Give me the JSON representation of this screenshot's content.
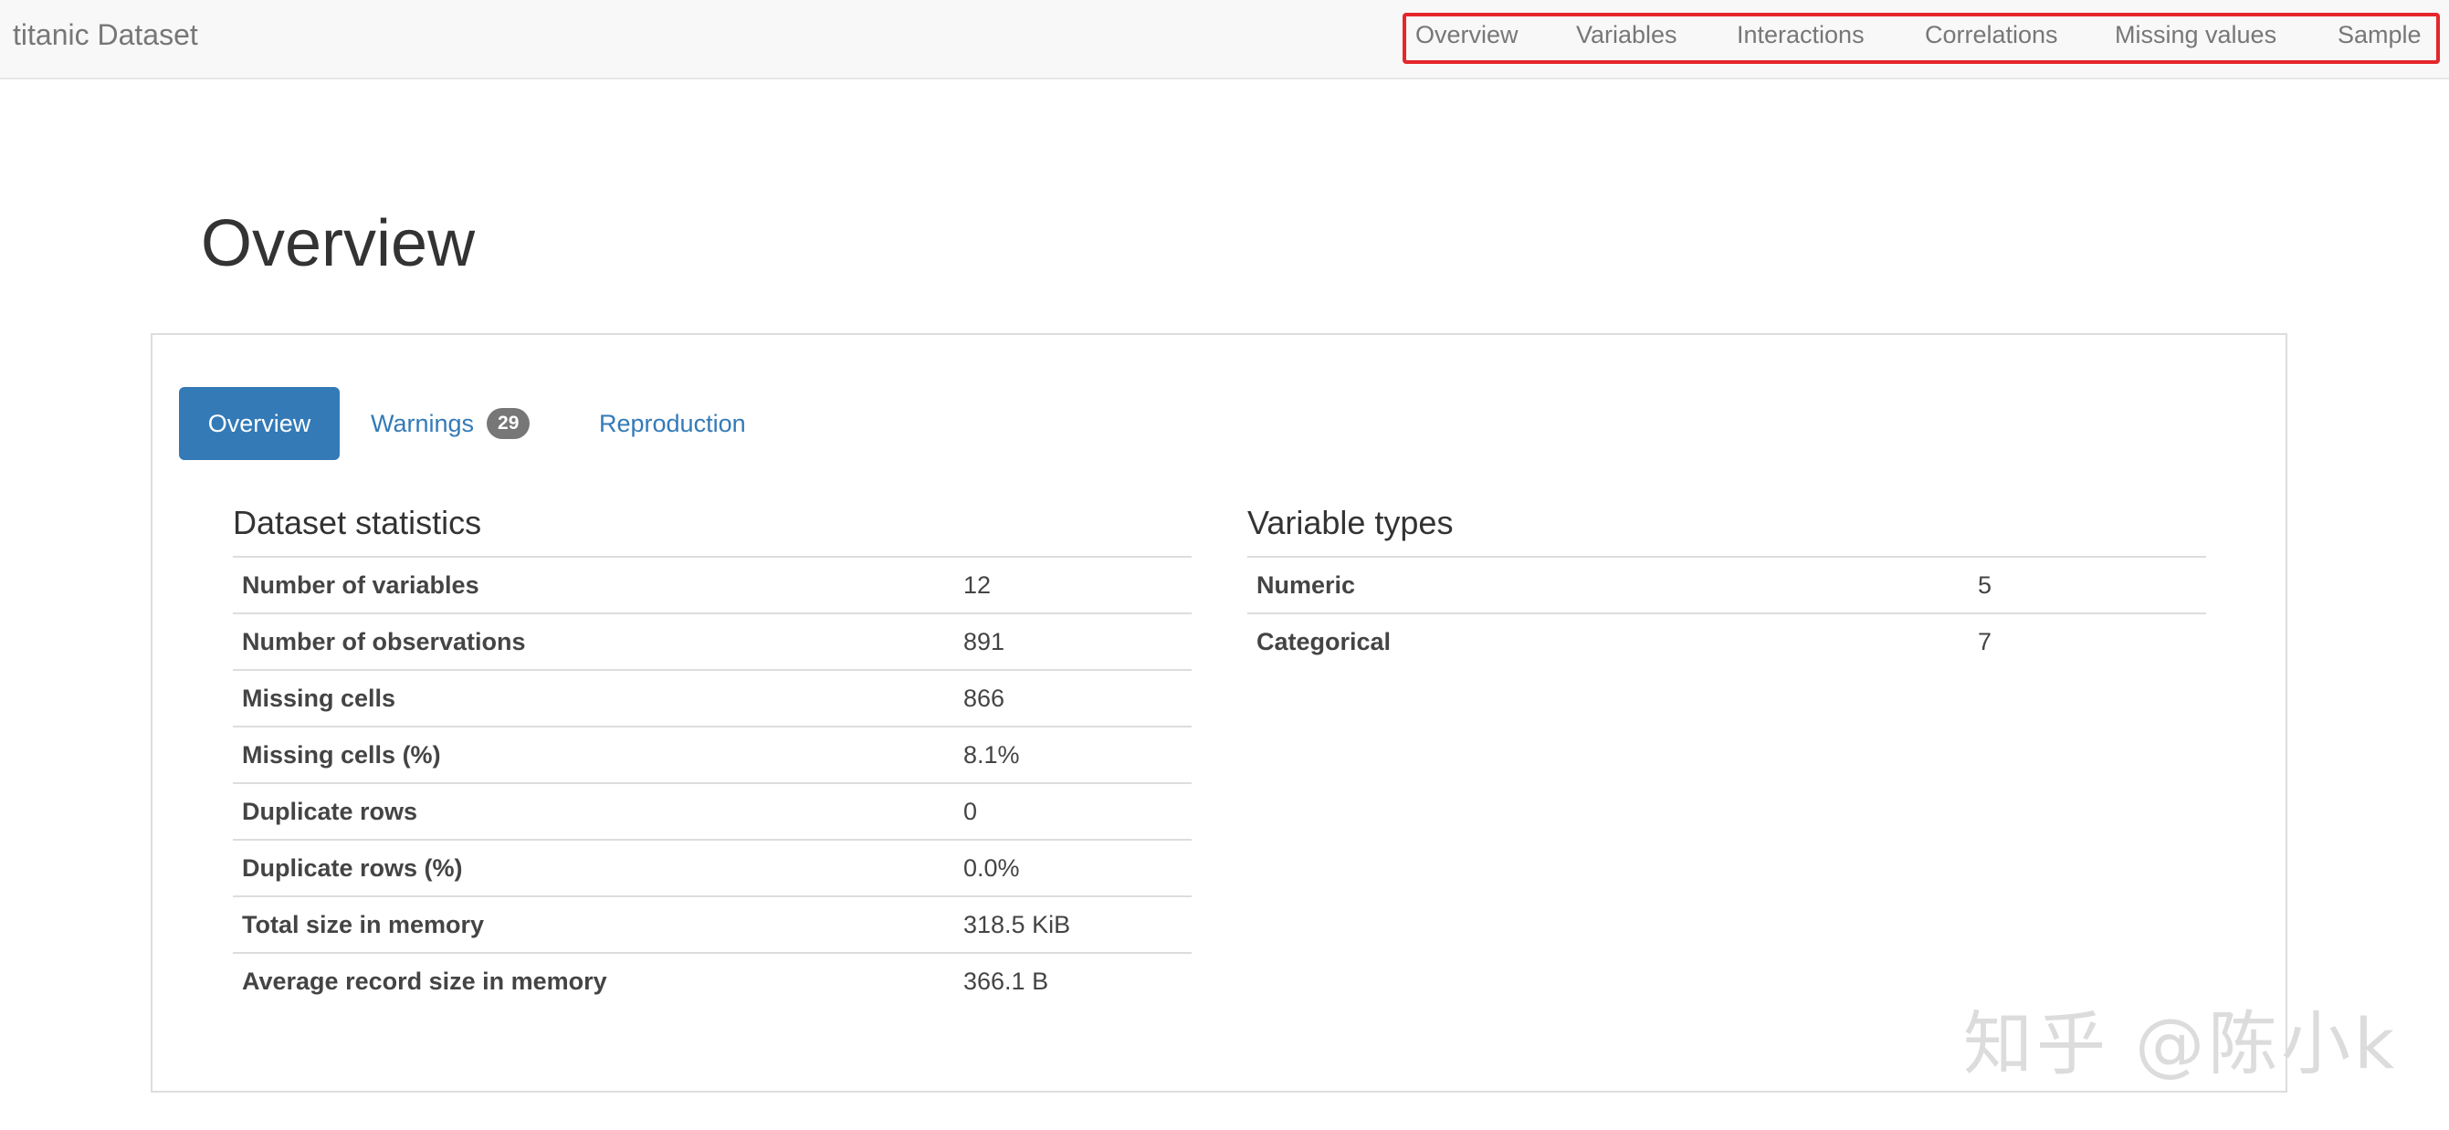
{
  "navbar": {
    "brand": "titanic Dataset",
    "links": [
      {
        "label": "Overview"
      },
      {
        "label": "Variables"
      },
      {
        "label": "Interactions"
      },
      {
        "label": "Correlations"
      },
      {
        "label": "Missing values"
      },
      {
        "label": "Sample"
      }
    ],
    "highlight_color": "#e5262b"
  },
  "page": {
    "title": "Overview"
  },
  "tabs": [
    {
      "label": "Overview",
      "active": true
    },
    {
      "label": "Warnings",
      "badge": "29",
      "active": false
    },
    {
      "label": "Reproduction",
      "active": false
    }
  ],
  "dataset_statistics": {
    "title": "Dataset statistics",
    "rows": [
      {
        "label": "Number of variables",
        "value": "12"
      },
      {
        "label": "Number of observations",
        "value": "891"
      },
      {
        "label": "Missing cells",
        "value": "866"
      },
      {
        "label": "Missing cells (%)",
        "value": "8.1%"
      },
      {
        "label": "Duplicate rows",
        "value": "0"
      },
      {
        "label": "Duplicate rows (%)",
        "value": "0.0%"
      },
      {
        "label": "Total size in memory",
        "value": "318.5 KiB"
      },
      {
        "label": "Average record size in memory",
        "value": "366.1 B"
      }
    ]
  },
  "variable_types": {
    "title": "Variable types",
    "rows": [
      {
        "label": "Numeric",
        "value": "5"
      },
      {
        "label": "Categorical",
        "value": "7"
      }
    ]
  },
  "watermark": "知乎 @陈小k",
  "colors": {
    "primary": "#337ab7",
    "navbar_bg": "#f8f8f8",
    "badge_bg": "#777777"
  }
}
